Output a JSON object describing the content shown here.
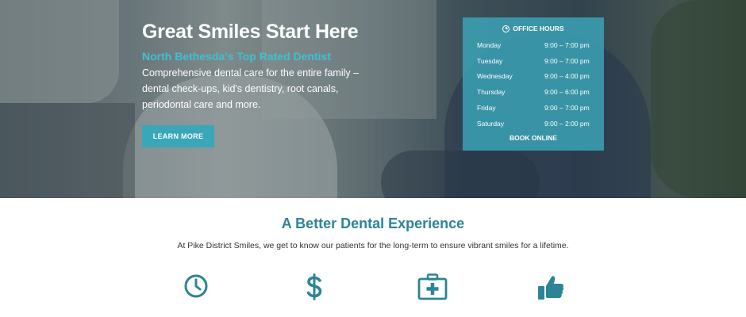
{
  "hero": {
    "title": "Great Smiles Start Here",
    "subtitle": "North Bethesda's Top Rated Dentist",
    "description": "Comprehensive dental care for the entire family – dental check-ups, kid's dentistry, root canals, periodontal care and more.",
    "button_label": "LEARN MORE"
  },
  "office_hours": {
    "title": "OFFICE HOURS",
    "rows": [
      {
        "day": "Monday",
        "time": "9:00 – 7:00 pm"
      },
      {
        "day": "Tuesday",
        "time": "9:00 – 7:00 pm"
      },
      {
        "day": "Wednesday",
        "time": "9:00 – 4:00 pm"
      },
      {
        "day": "Thursday",
        "time": "9:00 – 6:00 pm"
      },
      {
        "day": "Friday",
        "time": "9:00 – 7:00 pm"
      },
      {
        "day": "Saturday",
        "time": "9:00 – 2:00 pm"
      }
    ],
    "book_label": "BOOK ONLINE"
  },
  "section": {
    "title": "A Better Dental Experience",
    "text": "At Pike District Smiles, we get to know our patients for the long-term to ensure vibrant smiles for a lifetime."
  },
  "features": [
    {
      "icon": "clock-icon",
      "label": ""
    },
    {
      "icon": "dollar-icon",
      "label": ""
    },
    {
      "icon": "medical-kit-icon",
      "label": ""
    },
    {
      "icon": "thumbs-up-icon",
      "label": ""
    }
  ],
  "colors": {
    "accent": "#3ec1d3",
    "brand": "#2c8496",
    "button": "#3aa6b9"
  }
}
